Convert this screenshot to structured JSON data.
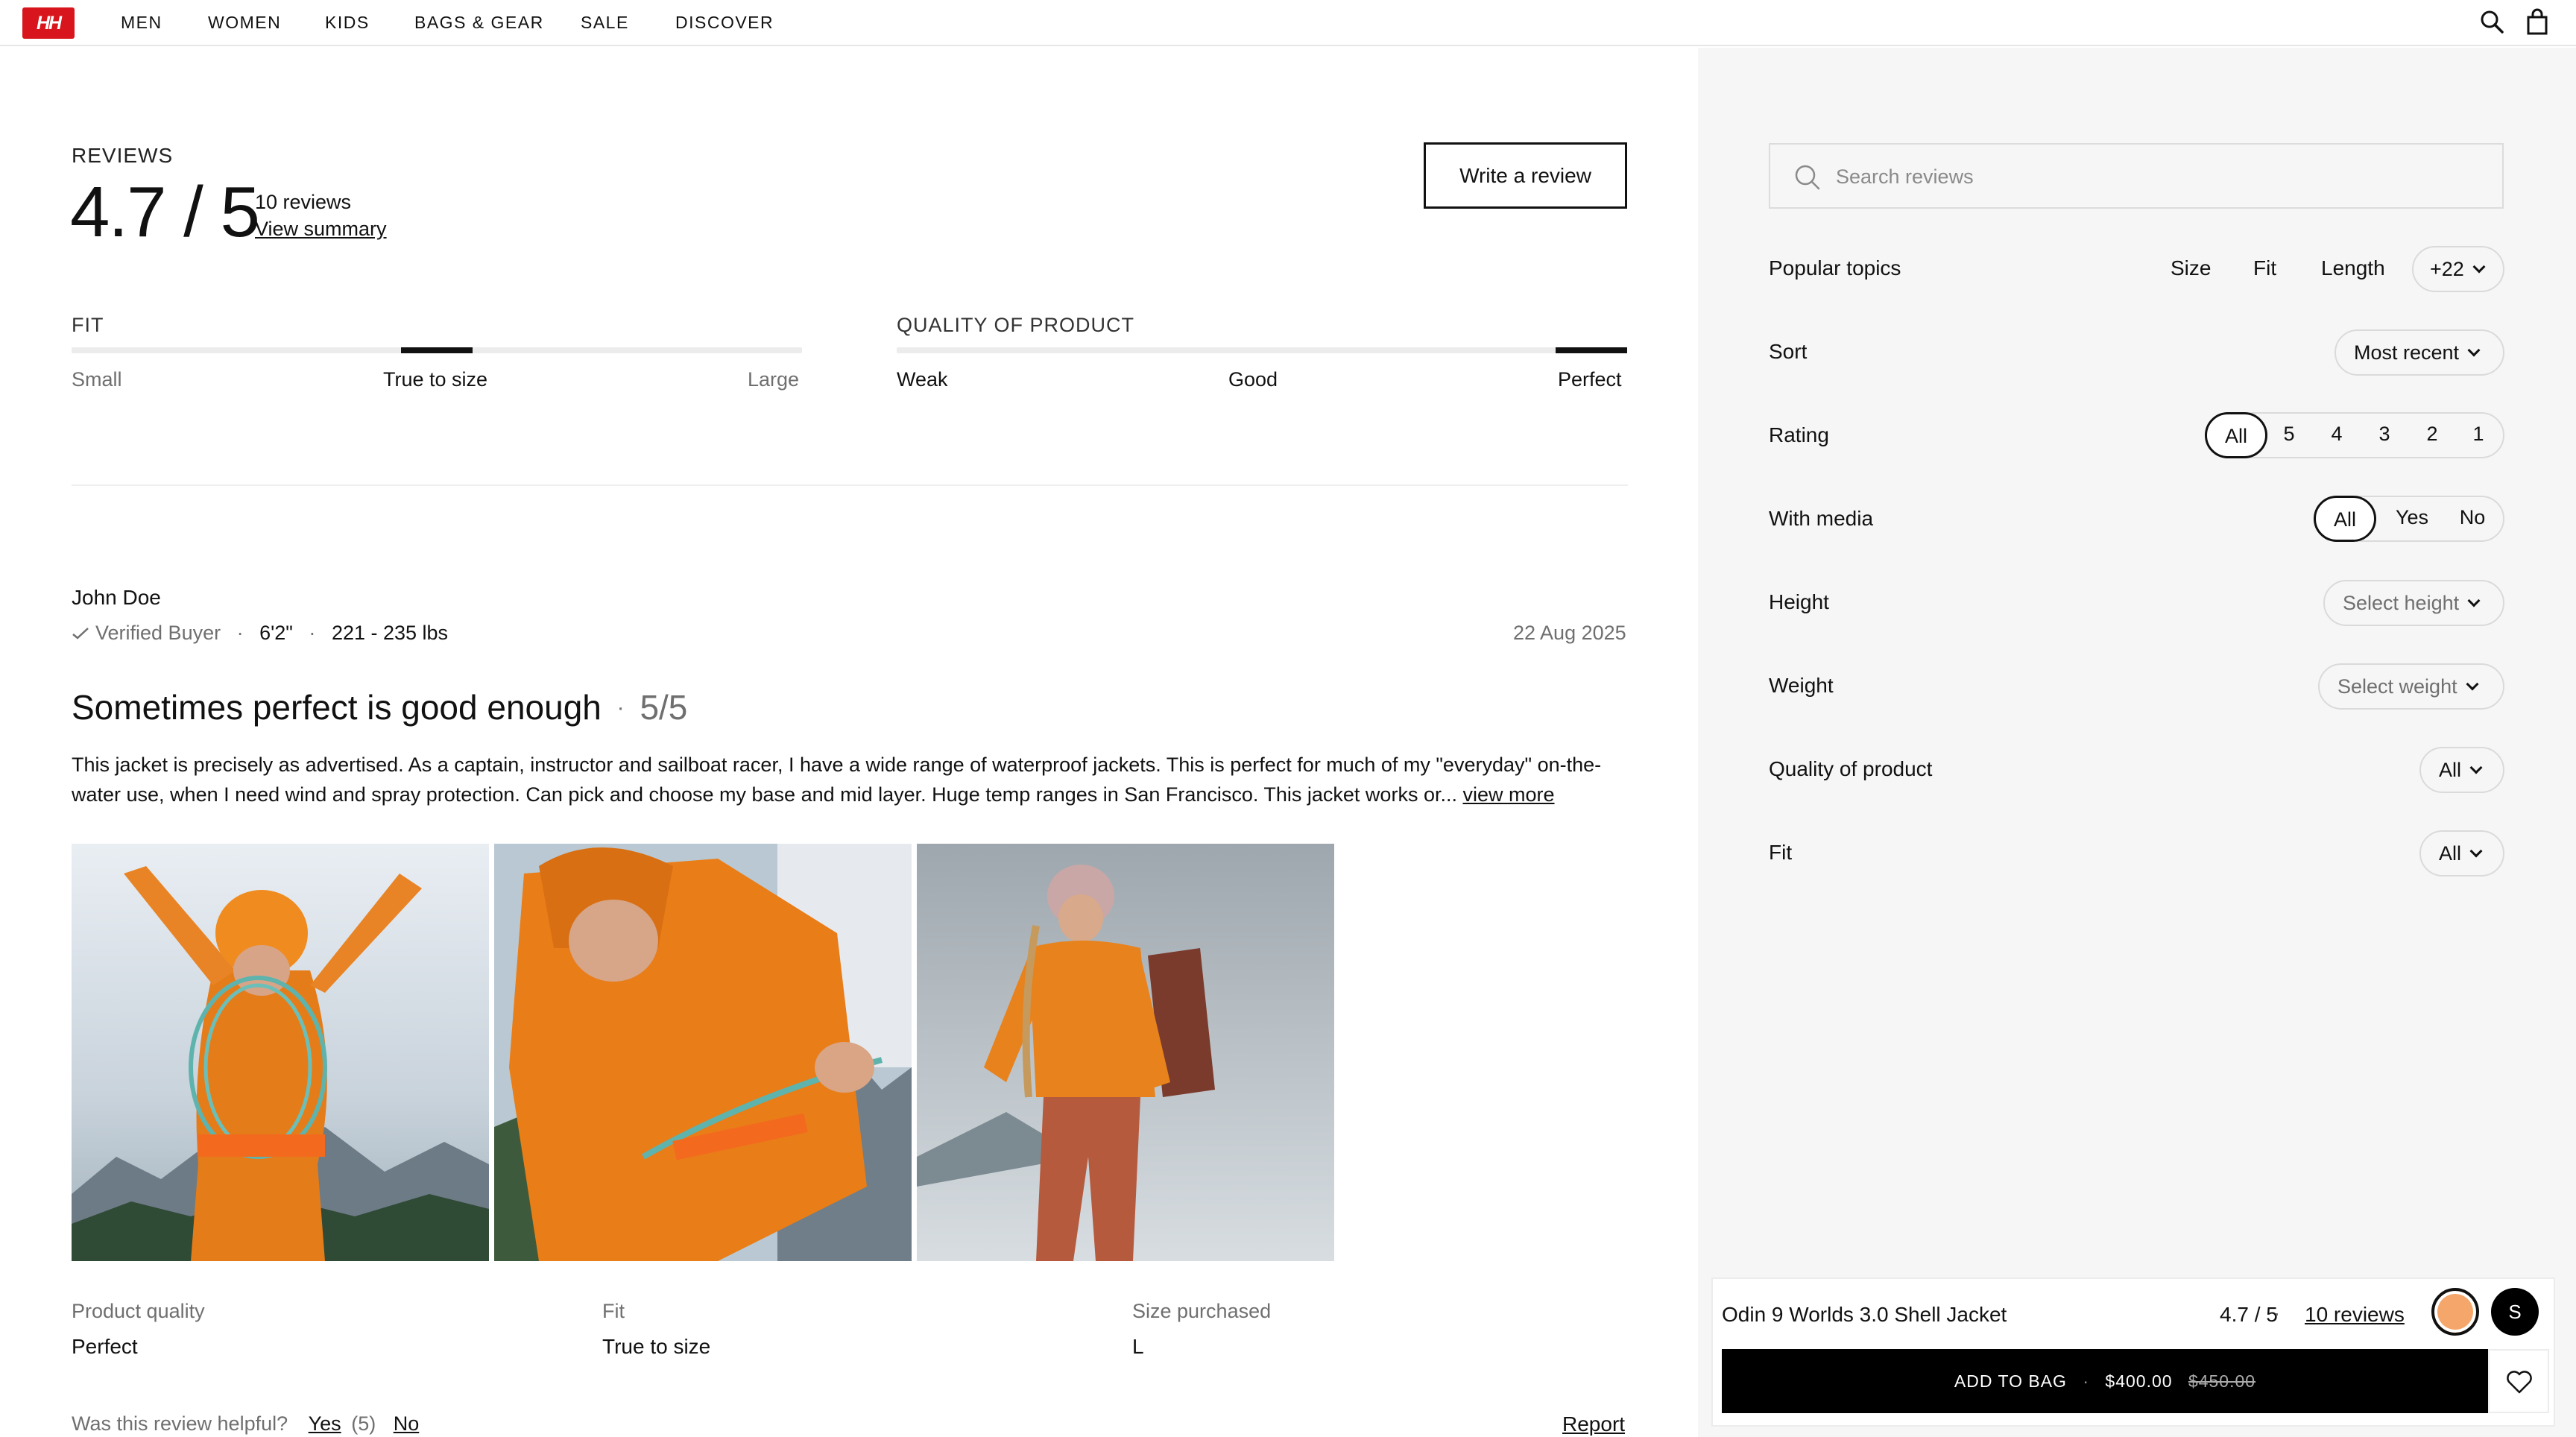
{
  "brand": {
    "logo_text": "HH",
    "accent": "#d8141c"
  },
  "nav": {
    "items": [
      "MEN",
      "WOMEN",
      "KIDS",
      "BAGS & GEAR",
      "SALE",
      "DISCOVER"
    ],
    "icons": [
      "search-icon",
      "bag-icon"
    ]
  },
  "reviews": {
    "heading": "REVIEWS",
    "rating": "4.7 / 5",
    "count": "10 reviews",
    "view_summary": "View summary",
    "write_button": "Write a review",
    "fit": {
      "title": "FIT",
      "labels": [
        "Small",
        "True to size",
        "Large"
      ],
      "level": 0.5
    },
    "quality": {
      "title": "QUALITY OF PRODUCT",
      "labels": [
        "Weak",
        "Good",
        "Perfect"
      ],
      "level": 1.0
    }
  },
  "review": {
    "author": "John Doe",
    "verified": "Verified Buyer",
    "height": "6'2\"",
    "weight": "221 - 235 lbs",
    "date": "22 Aug 2025",
    "title": "Sometimes perfect is good enough",
    "score": "5/5",
    "body": "This jacket is precisely as advertised. As a captain, instructor and sailboat racer, I have a wide range of waterproof jackets. This is perfect for much of my \"everyday\" on-the-water use, when I need wind and spray protection. Can pick and choose my base and mid layer. Huge temp ranges in San Francisco. This jacket works or...",
    "view_more": "view more",
    "details": [
      {
        "label": "Product quality",
        "value": "Perfect"
      },
      {
        "label": "Fit",
        "value": "True to size"
      },
      {
        "label": "Size purchased",
        "value": "L"
      }
    ],
    "helpful_question": "Was this review helpful?",
    "yes": "Yes",
    "yes_count": "(5)",
    "no": "No",
    "report": "Report"
  },
  "filters": {
    "search_placeholder": "Search reviews",
    "popular_topics": {
      "label": "Popular topics",
      "topics": [
        "Size",
        "Fit",
        "Length"
      ],
      "more": "+22"
    },
    "sort": {
      "label": "Sort",
      "value": "Most recent"
    },
    "rating": {
      "label": "Rating",
      "options": [
        "All",
        "5",
        "4",
        "3",
        "2",
        "1"
      ],
      "selected": "All"
    },
    "with_media": {
      "label": "With media",
      "options": [
        "All",
        "Yes",
        "No"
      ],
      "selected": "All"
    },
    "height": {
      "label": "Height",
      "placeholder": "Select height"
    },
    "weight": {
      "label": "Weight",
      "placeholder": "Select weight"
    },
    "quality": {
      "label": "Quality of product",
      "value": "All"
    },
    "fit": {
      "label": "Fit",
      "value": "All"
    }
  },
  "sticky": {
    "product": "Odin 9 Worlds 3.0 Shell Jacket",
    "rating": "4.7 / 5",
    "reviews_link": "10 reviews",
    "swatch_color": "#f5a66a",
    "size": "S",
    "add_to_bag": "ADD TO BAG",
    "price": "$400.00",
    "old_price": "$450.00"
  }
}
